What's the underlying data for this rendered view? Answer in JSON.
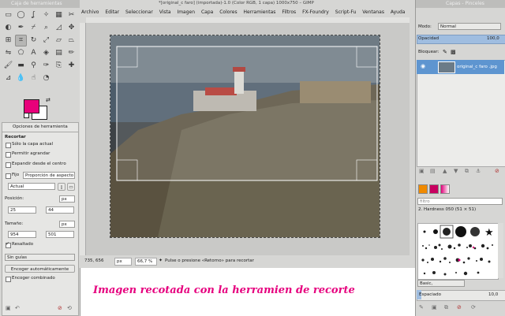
{
  "toolbox": {
    "title": "Caja de herramientas",
    "tool_options_tab": "Opciones de herramienta",
    "section_title": "Recortar",
    "options": {
      "current_layer_only": "Sólo la capa actual",
      "allow_growing": "Permitir agrandar",
      "expand_from_center": "Expandir desde el centro",
      "fixed": "Fijo",
      "aspect": "Proporción de aspecto",
      "ratio_value": "Actual",
      "position_label": "Posición:",
      "pos_x": "25",
      "pos_y": "44",
      "pos_unit": "px",
      "size_label": "Tamaño:",
      "size_w": "954",
      "size_h": "501",
      "size_unit": "px",
      "highlight": "Resaltado",
      "guides": "Sin guías",
      "autoshrink": "Encoger automáticamente",
      "shrink_merged": "Encoger combinado"
    },
    "fg_color": "#e8007a",
    "bg_color": "#ffffff"
  },
  "image_window": {
    "title": "*[original_c faro] (importada)-1.0 (Color RGB, 1 capa) 1000x750 – GIMP",
    "menu": [
      "Archivo",
      "Editar",
      "Seleccionar",
      "Vista",
      "Imagen",
      "Capa",
      "Colores",
      "Herramientas",
      "Filtros",
      "FX-Foundry",
      "Script-Fu",
      "Ventanas",
      "Ayuda"
    ],
    "status": {
      "coords": "735, 656",
      "unit": "px",
      "zoom": "66,7 %",
      "message": "Pulse o presione «Retorno» para recortar"
    }
  },
  "caption": "Imagen recotada con la herramien de recorte",
  "dock": {
    "title": "Capas - Pinceles",
    "mode_label": "Modo:",
    "mode_value": "Normal",
    "opacity_label": "Opacidad",
    "opacity_value": "100,0",
    "lock_label": "Bloquear:",
    "layer_name": "original_c faro .jpg",
    "brush_filter": "filtro",
    "brush_name": "2. Hardness 050 (51 × 51)",
    "brush_set": "Basic,",
    "spacing_label": "Espaciado",
    "spacing_value": "10,0"
  }
}
